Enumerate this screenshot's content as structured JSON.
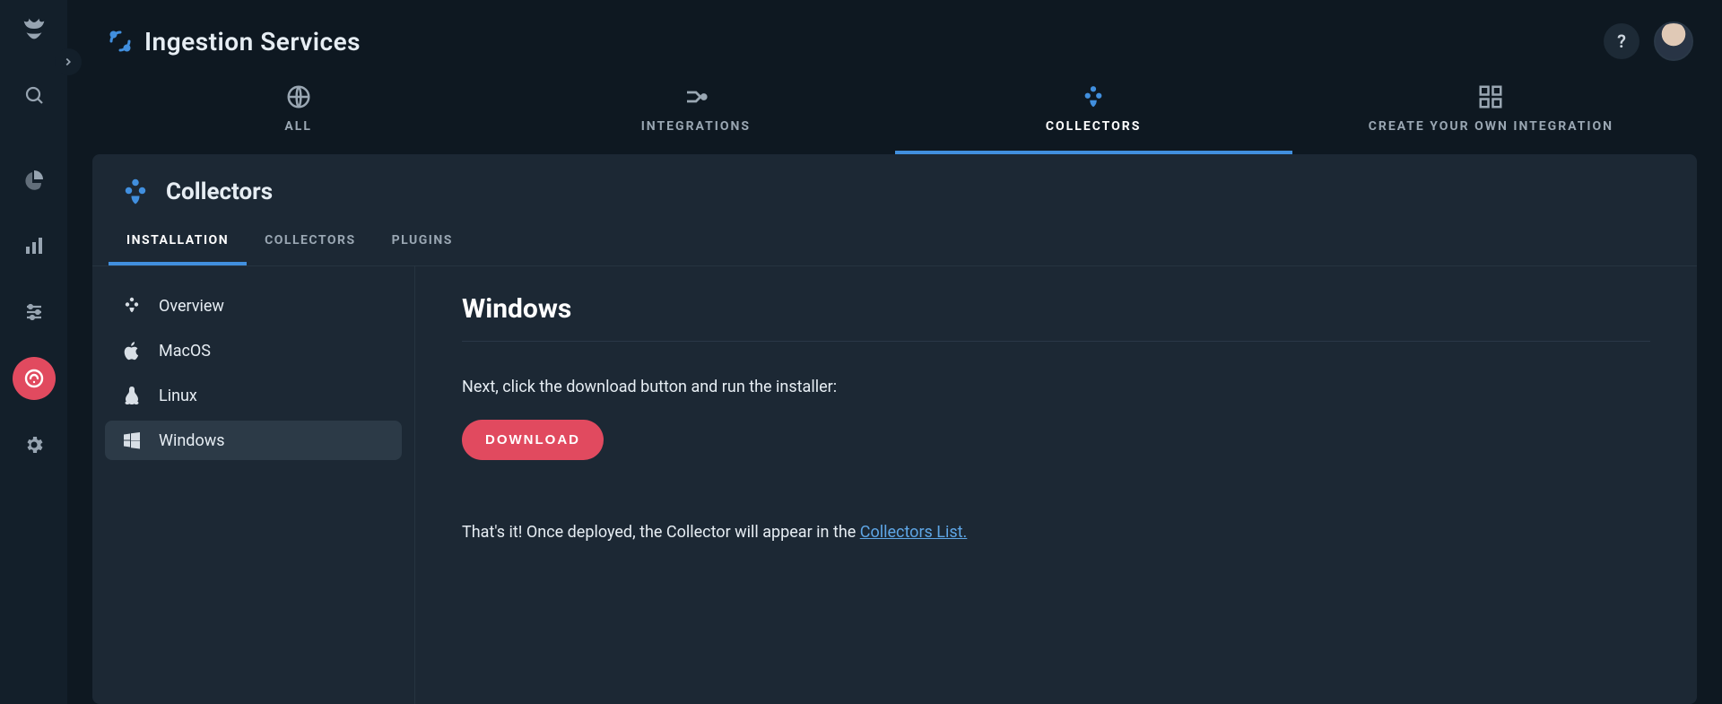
{
  "header": {
    "title": "Ingestion Services"
  },
  "topnav": {
    "all": "ALL",
    "integrations": "INTEGRATIONS",
    "collectors": "COLLECTORS",
    "create": "CREATE YOUR OWN INTEGRATION"
  },
  "card": {
    "title": "Collectors"
  },
  "subtabs": {
    "installation": "INSTALLATION",
    "collectors": "COLLECTORS",
    "plugins": "PLUGINS"
  },
  "side": {
    "overview": "Overview",
    "macos": "MacOS",
    "linux": "Linux",
    "windows": "Windows"
  },
  "content": {
    "heading": "Windows",
    "instruction": "Next, click the download button and run the installer:",
    "download": "DOWNLOAD",
    "after_prefix": "That's it! Once deployed, the Collector will appear in the ",
    "after_link": "Collectors List."
  },
  "help": "?"
}
